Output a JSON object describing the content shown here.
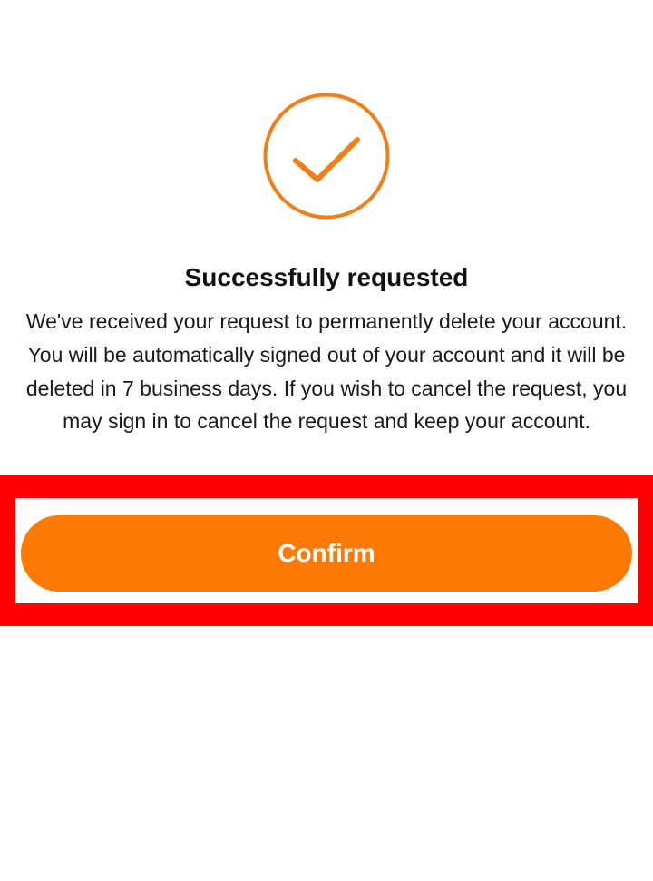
{
  "icon": {
    "name": "checkmark-circle-icon",
    "color": "#f17e17"
  },
  "dialog": {
    "title": "Successfully requested",
    "message": "We've received your request to permanently delete your account. You will be automatically signed out of your account and it will be deleted in 7 business days. If you wish to cancel the request, you may sign in to cancel the request and keep your account.",
    "confirm_label": "Confirm"
  },
  "colors": {
    "accent": "#fd7a05",
    "highlight": "#ff0000",
    "text": "#111111"
  }
}
